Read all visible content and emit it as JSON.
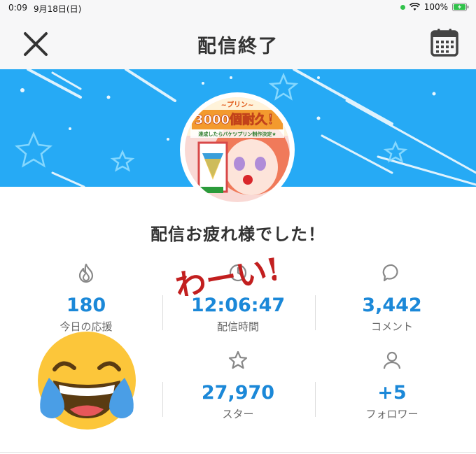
{
  "status_bar": {
    "time": "0:09",
    "date": "9月18日(日)",
    "battery": "100%"
  },
  "header": {
    "title": "配信終了",
    "close_icon": "close-icon",
    "calendar_icon": "calendar-icon"
  },
  "colors": {
    "banner": "#26aaf5",
    "accent": "#1b88d8"
  },
  "avatar_text": {
    "line1": "~プリン~",
    "line2": "3000個耐久！",
    "line3": "達成したらバケツプリン制作決定★"
  },
  "message": "配信お疲れ様でした！",
  "handwriting": "わーい!",
  "stats": [
    {
      "icon": "flame-icon",
      "value": "180",
      "label": "今日の応援"
    },
    {
      "icon": "clock-icon",
      "value": "12:06:47",
      "label": "配信時間"
    },
    {
      "icon": "comment-icon",
      "value": "3,442",
      "label": "コメント"
    },
    {
      "icon": "laughing-emoji-icon",
      "value": "",
      "label": ""
    },
    {
      "icon": "star-icon",
      "value": "27,970",
      "label": "スター"
    },
    {
      "icon": "person-icon",
      "value": "+5",
      "label": "フォロワー"
    }
  ]
}
